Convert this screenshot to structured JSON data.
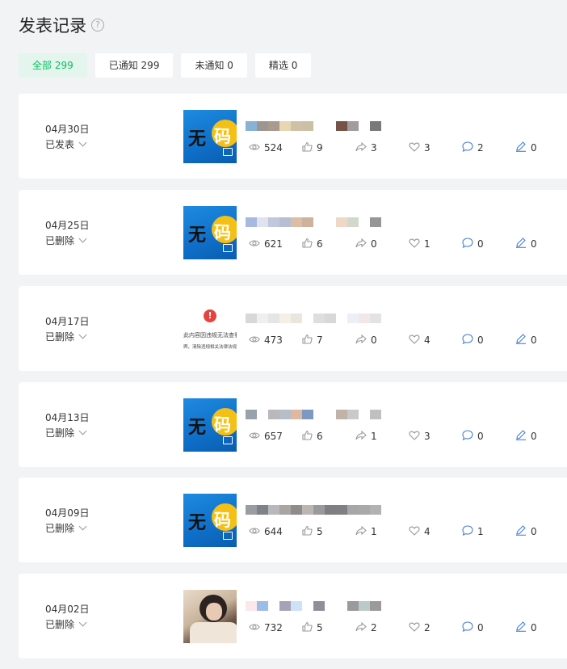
{
  "page": {
    "title": "发表记录",
    "help_icon": "question-circle-icon"
  },
  "tabs": [
    {
      "label": "全部 299",
      "active": true
    },
    {
      "label": "已通知 299",
      "active": false
    },
    {
      "label": "未通知 0",
      "active": false
    },
    {
      "label": "精选 0",
      "active": false
    }
  ],
  "thumb_text": {
    "watermark_char1": "无",
    "watermark_char2": "码",
    "error_mark": "!",
    "error_line1": "此内容因违规无法查看",
    "error_line2": "舆，清除违规相关法律法规"
  },
  "posts": [
    {
      "date": "04月30日",
      "status": "已发表",
      "thumb": "watermark",
      "views": "524",
      "likes": "9",
      "shares": "3",
      "favorites": "3",
      "comments": "2",
      "edits": "0",
      "blur": [
        "#88b2d4",
        "#9d9690",
        "#a89a8c",
        "#e8d6b3",
        "#cfc1a8",
        "#cbc0a5",
        "#fff",
        "#fff",
        "#765248",
        "#a09d9c",
        "#fff",
        "#7a7878"
      ]
    },
    {
      "date": "04月25日",
      "status": "已删除",
      "thumb": "watermark",
      "views": "621",
      "likes": "6",
      "shares": "0",
      "favorites": "1",
      "comments": "0",
      "edits": "0",
      "blur": [
        "#a7b9df",
        "#dfe3ee",
        "#c2c8db",
        "#b4bfd4",
        "#dbbea5",
        "#cfb29c",
        "#fff",
        "#fff",
        "#efd8c7",
        "#d2d9cb",
        "#fff",
        "#969696"
      ]
    },
    {
      "date": "04月17日",
      "status": "已删除",
      "thumb": "error",
      "views": "473",
      "likes": "7",
      "shares": "0",
      "favorites": "4",
      "comments": "0",
      "edits": "0",
      "blur": [
        "#d8d8d8",
        "#efefef",
        "#e5e5e5",
        "#f5efe6",
        "#ebe6dd",
        "#fff",
        "#dedede",
        "#d8d8d8",
        "#fff",
        "#edeff7",
        "#f3e6e8",
        "#e3e3e3"
      ]
    },
    {
      "date": "04月13日",
      "status": "已删除",
      "thumb": "watermark",
      "views": "657",
      "likes": "6",
      "shares": "1",
      "favorites": "3",
      "comments": "0",
      "edits": "0",
      "blur": [
        "#99a1ad",
        "#fff",
        "#b8b8bd",
        "#b6bec8",
        "#deb8a0",
        "#7c98c3",
        "#fff",
        "#fff",
        "#c0b3a8",
        "#c9c9c9",
        "#fff",
        "#c0c0c0"
      ]
    },
    {
      "date": "04月09日",
      "status": "已删除",
      "thumb": "watermark",
      "views": "644",
      "likes": "5",
      "shares": "1",
      "favorites": "4",
      "comments": "1",
      "edits": "0",
      "blur": [
        "#9a9ca3",
        "#7f8389",
        "#b9b9bb",
        "#a8a5a3",
        "#8f8c8c",
        "#bcb5b2",
        "#9a9a9c",
        "#7f7f82",
        "#808083",
        "#a7a7a9",
        "#a9a9a9",
        "#b2b2b2"
      ]
    },
    {
      "date": "04月02日",
      "status": "已删除",
      "thumb": "photo",
      "views": "732",
      "likes": "5",
      "shares": "2",
      "favorites": "2",
      "comments": "0",
      "edits": "0",
      "blur": [
        "#fbe8ea",
        "#9dbde9",
        "#fff",
        "#a6a3b7",
        "#cde2f6",
        "#fff",
        "#8f8f9c",
        "#fff",
        "#fff",
        "#9a9a9c",
        "#bbcac7",
        "#9a9a9a"
      ]
    }
  ]
}
